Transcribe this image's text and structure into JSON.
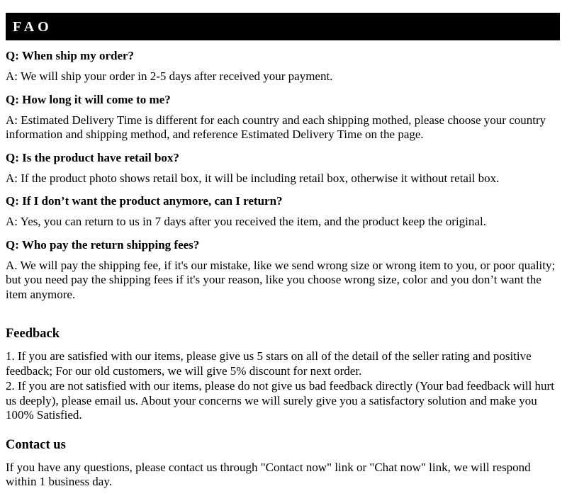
{
  "header": {
    "title": "FAO"
  },
  "faq": {
    "items": [
      {
        "question": "Q: When ship my order?",
        "answer": "A: We will ship your order in 2-5 days after received your payment."
      },
      {
        "question": "Q: How long it will come to me?",
        "answer": "A: Estimated Delivery Time is different for each country and each shipping mothed, please choose your country information and shipping method, and reference Estimated Delivery Time on the page."
      },
      {
        "question": "Q: Is the product have retail box?",
        "answer": "A: If  the product photo shows retail box, it will be including retail box, otherwise it without retail box."
      },
      {
        "question": "Q: If I don’t want the product anymore, can I return?",
        "answer": "A: Yes, you can return to us in 7 days after you received the item, and the product keep the original."
      },
      {
        "question": "Q: Who pay the return shipping fees?",
        "answer": "A.  We will pay the shipping fee, if  it's our mistake, like we send wrong size or wrong item to you, or poor quality; but you need pay the shipping fees if  it's your reason, like you choose wrong size, color and you don’t want the item anymore."
      }
    ]
  },
  "feedback": {
    "heading": "Feedback",
    "paragraphs": [
      "1.  If you are satisfied with our items, please give us 5 stars on all of the detail of the seller rating and positive feedback; For our old customers, we will give 5% discount for next order.",
      "2.  If you are not satisfied with our items, please do not give us bad feedback directly (Your bad feedback will hurt us deeply), please email us. About your concerns we will surely give you a satisfactory solution and make you 100% Satisfied."
    ]
  },
  "contact": {
    "heading": "Contact us",
    "paragraphs": [
      "If you have any questions, please contact us through \"Contact now\" link or \"Chat now\" link, we will respond within 1 business day."
    ]
  },
  "colors": {
    "header_background": "#000000",
    "header_text": "#ffffff",
    "body_text": "#000000",
    "page_background": "#ffffff"
  }
}
